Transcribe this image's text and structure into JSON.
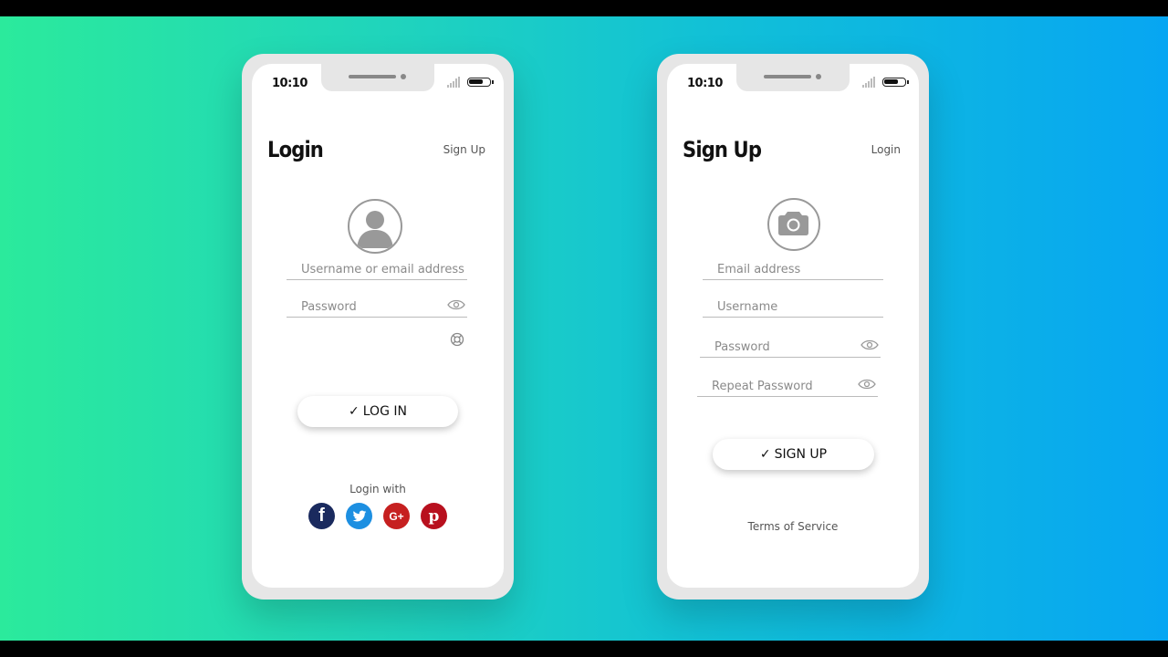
{
  "login": {
    "time": "10:10",
    "title": "Login",
    "top_link": "Sign Up",
    "username_placeholder": "Username or email address",
    "password_placeholder": "Password",
    "button_label": "LOG IN",
    "login_with": "Login with",
    "socials": [
      {
        "name": "facebook",
        "color": "#1a2a5e"
      },
      {
        "name": "twitter",
        "color": "#1d8fe1"
      },
      {
        "name": "google-plus",
        "color": "#c62020"
      },
      {
        "name": "pinterest",
        "color": "#b8101e"
      }
    ]
  },
  "signup": {
    "time": "10:10",
    "title": "Sign Up",
    "top_link": "Login",
    "email_placeholder": "Email address",
    "username_placeholder": "Username",
    "password_placeholder": "Password",
    "repeat_password_placeholder": "Repeat Password",
    "button_label": "SIGN UP",
    "terms": "Terms of Service"
  },
  "colors": {
    "gradient_start": "#2bea9c",
    "gradient_end": "#07a6f2",
    "phone_frame": "#e6e6e6",
    "icon_gray": "#999999"
  }
}
